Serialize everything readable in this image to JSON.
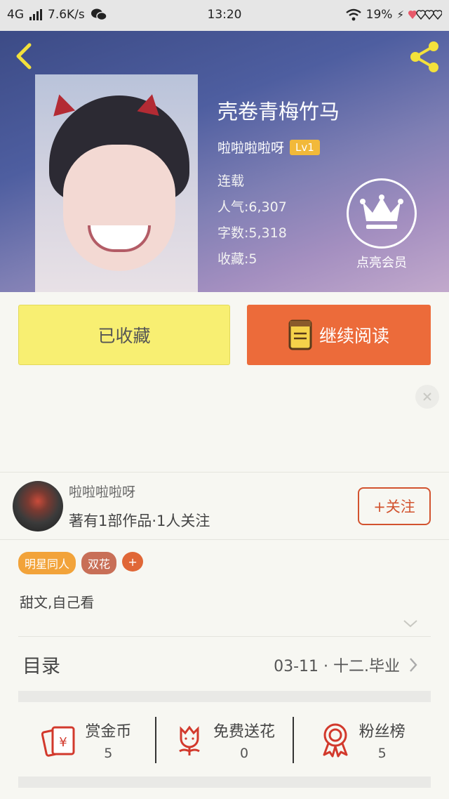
{
  "status_bar": {
    "network": "4G",
    "speed": "7.6K/s",
    "time": "13:20",
    "battery": "19%"
  },
  "icons": {
    "back": "back-arrow-icon",
    "share": "share-icon",
    "vip": "crown-icon",
    "read": "book-icon",
    "coin": "red-envelope-icon",
    "flower": "flower-icon",
    "fans": "medal-icon"
  },
  "book": {
    "title": "壳卷青梅竹马",
    "author": "啦啦啦啦呀",
    "level": "Lv1",
    "status": "连载",
    "popularity": "人气:6,307",
    "word_count": "字数:5,318",
    "favorites": "收藏:5"
  },
  "vip": {
    "label": "点亮会员"
  },
  "actions": {
    "favorited_label": "已收藏",
    "continue_label": "继续阅读"
  },
  "author_card": {
    "name": "啦啦啦啦呀",
    "works": "著有1部作品·1人关注",
    "follow_label": "+关注"
  },
  "tags": [
    "明星同人",
    "双花",
    "+"
  ],
  "description": "甜文,自己看",
  "toc": {
    "label": "目录",
    "latest": "03-11 · 十二.毕业"
  },
  "stats": [
    {
      "label": "赏金币",
      "value": "5"
    },
    {
      "label": "免费送花",
      "value": "0"
    },
    {
      "label": "粉丝榜",
      "value": "5"
    }
  ],
  "colors": {
    "accent": "#ec6b3a",
    "favorite_button": "#f8ef72",
    "level_badge": "#f2b93a",
    "header_yellow_icons": "#f3e13b"
  }
}
